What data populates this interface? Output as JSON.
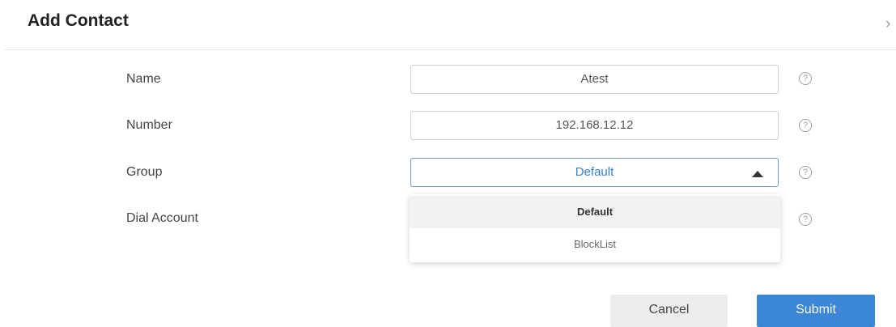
{
  "dialog": {
    "title": "Add Contact",
    "close_glyph": "›"
  },
  "form": {
    "fields": [
      {
        "label": "Name",
        "value": "Atest"
      },
      {
        "label": "Number",
        "value": "192.168.12.12"
      },
      {
        "label": "Group",
        "value": "Default"
      },
      {
        "label": "Dial Account",
        "value": ""
      }
    ],
    "help_glyph": "?"
  },
  "group_dropdown": {
    "open": true,
    "options": [
      "Default",
      "BlockList"
    ],
    "selected": "Default"
  },
  "buttons": {
    "cancel": "Cancel",
    "submit": "Submit"
  },
  "colors": {
    "accent": "#3b86d6",
    "select_text": "#3a7fcf"
  }
}
